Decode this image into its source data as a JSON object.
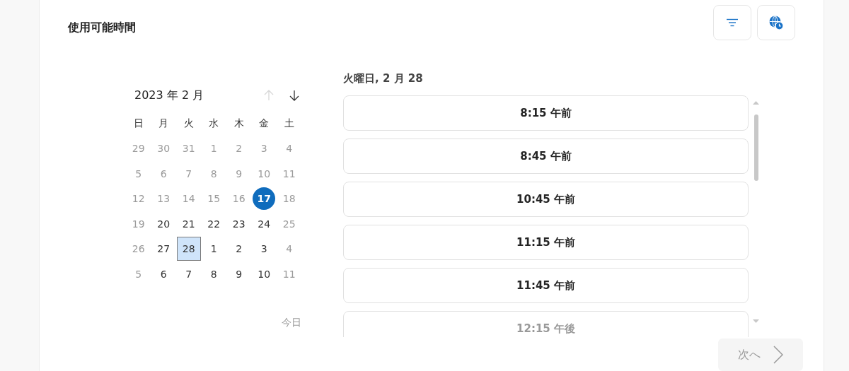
{
  "title": "使用可能時間",
  "toolbar": [
    {
      "kind": "filter"
    },
    {
      "kind": "timezone"
    }
  ],
  "calendar": {
    "month_label": "2023 年 2 月",
    "prev_disabled": true,
    "next_disabled": false,
    "weekdays": [
      "日",
      "月",
      "火",
      "水",
      "木",
      "金",
      "土"
    ],
    "days": [
      {
        "label": "29",
        "available": false,
        "today": false,
        "selected": false
      },
      {
        "label": "30",
        "available": false,
        "today": false,
        "selected": false
      },
      {
        "label": "31",
        "available": false,
        "today": false,
        "selected": false
      },
      {
        "label": "1",
        "available": false,
        "today": false,
        "selected": false
      },
      {
        "label": "2",
        "available": false,
        "today": false,
        "selected": false
      },
      {
        "label": "3",
        "available": false,
        "today": false,
        "selected": false
      },
      {
        "label": "4",
        "available": false,
        "today": false,
        "selected": false
      },
      {
        "label": "5",
        "available": false,
        "today": false,
        "selected": false
      },
      {
        "label": "6",
        "available": false,
        "today": false,
        "selected": false
      },
      {
        "label": "7",
        "available": false,
        "today": false,
        "selected": false
      },
      {
        "label": "8",
        "available": false,
        "today": false,
        "selected": false
      },
      {
        "label": "9",
        "available": false,
        "today": false,
        "selected": false
      },
      {
        "label": "10",
        "available": false,
        "today": false,
        "selected": false
      },
      {
        "label": "11",
        "available": false,
        "today": false,
        "selected": false
      },
      {
        "label": "12",
        "available": false,
        "today": false,
        "selected": false
      },
      {
        "label": "13",
        "available": false,
        "today": false,
        "selected": false
      },
      {
        "label": "14",
        "available": false,
        "today": false,
        "selected": false
      },
      {
        "label": "15",
        "available": false,
        "today": false,
        "selected": false
      },
      {
        "label": "16",
        "available": false,
        "today": false,
        "selected": false
      },
      {
        "label": "17",
        "available": false,
        "today": true,
        "selected": false
      },
      {
        "label": "18",
        "available": false,
        "today": false,
        "selected": false
      },
      {
        "label": "19",
        "available": false,
        "today": false,
        "selected": false
      },
      {
        "label": "20",
        "available": true,
        "today": false,
        "selected": false
      },
      {
        "label": "21",
        "available": true,
        "today": false,
        "selected": false
      },
      {
        "label": "22",
        "available": true,
        "today": false,
        "selected": false
      },
      {
        "label": "23",
        "available": true,
        "today": false,
        "selected": false
      },
      {
        "label": "24",
        "available": true,
        "today": false,
        "selected": false
      },
      {
        "label": "25",
        "available": false,
        "today": false,
        "selected": false
      },
      {
        "label": "26",
        "available": false,
        "today": false,
        "selected": false
      },
      {
        "label": "27",
        "available": true,
        "today": false,
        "selected": false
      },
      {
        "label": "28",
        "available": true,
        "today": false,
        "selected": true
      },
      {
        "label": "1",
        "available": true,
        "today": false,
        "selected": false
      },
      {
        "label": "2",
        "available": true,
        "today": false,
        "selected": false
      },
      {
        "label": "3",
        "available": true,
        "today": false,
        "selected": false
      },
      {
        "label": "4",
        "available": false,
        "today": false,
        "selected": false
      },
      {
        "label": "5",
        "available": false,
        "today": false,
        "selected": false
      },
      {
        "label": "6",
        "available": true,
        "today": false,
        "selected": false
      },
      {
        "label": "7",
        "available": true,
        "today": false,
        "selected": false
      },
      {
        "label": "8",
        "available": true,
        "today": false,
        "selected": false
      },
      {
        "label": "9",
        "available": true,
        "today": false,
        "selected": false
      },
      {
        "label": "10",
        "available": true,
        "today": false,
        "selected": false
      },
      {
        "label": "11",
        "available": false,
        "today": false,
        "selected": false
      }
    ],
    "today_link": "今日"
  },
  "day_heading": "火曜日, 2 月 28",
  "slots": [
    {
      "label": "8:15 午前"
    },
    {
      "label": "8:45 午前"
    },
    {
      "label": "10:45 午前"
    },
    {
      "label": "11:15 午前"
    },
    {
      "label": "11:45 午前"
    },
    {
      "label": "12:15 午後"
    }
  ],
  "next_button": {
    "label": "次へ",
    "disabled": true
  }
}
